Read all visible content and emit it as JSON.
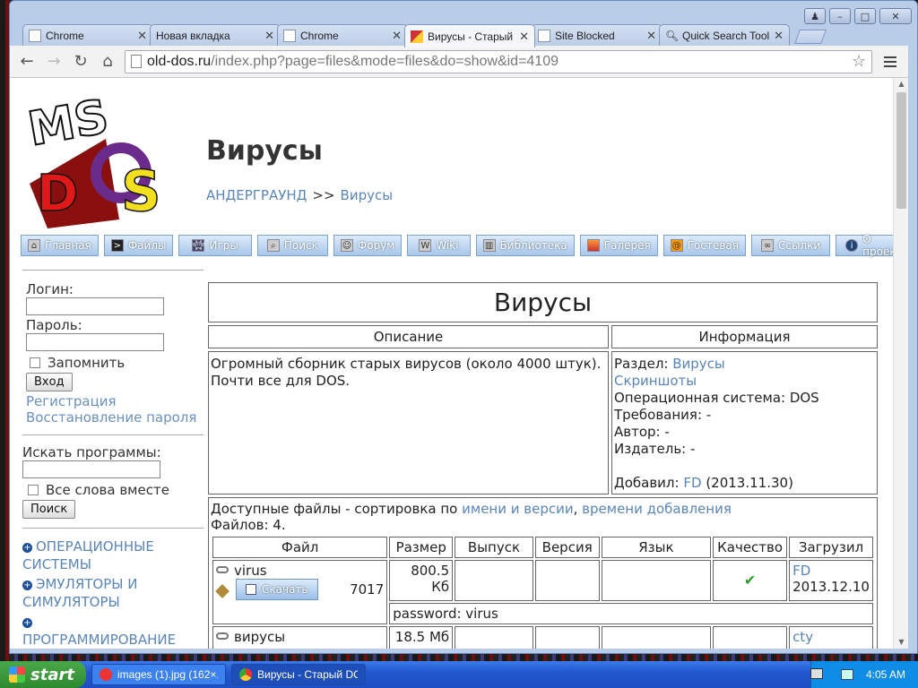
{
  "tabs": [
    {
      "title": "Chrome",
      "active": false
    },
    {
      "title": "Новая вкладка",
      "active": false
    },
    {
      "title": "Chrome",
      "active": false
    },
    {
      "title": "Вирусы - Старый DOS",
      "active": true
    },
    {
      "title": "Site Blocked",
      "active": false
    },
    {
      "title": "Quick Search Tool",
      "active": false
    }
  ],
  "url": {
    "host": "old-dos.ru",
    "rest": "/index.php?page=files&mode=files&do=show&id=4109"
  },
  "header": {
    "title": "Вирусы",
    "crumb_parent": "АНДЕРГРАУНД",
    "crumb_sep": ">>",
    "crumb_current": "Вирусы"
  },
  "nav": [
    {
      "label": "Главная",
      "icon": "home-icon"
    },
    {
      "label": "Файлы",
      "icon": "terminal-icon"
    },
    {
      "label": "Игры",
      "icon": "invader-icon"
    },
    {
      "label": "Поиск",
      "icon": "search-icon"
    },
    {
      "label": "Форум",
      "icon": "user-icon"
    },
    {
      "label": "Wiki",
      "icon": "wiki-icon"
    },
    {
      "label": "Библиотека",
      "icon": "book-icon"
    },
    {
      "label": "Галерея",
      "icon": "picture-icon"
    },
    {
      "label": "Гостевая",
      "icon": "guestbook-icon"
    },
    {
      "label": "Ссылки",
      "icon": "link-icon"
    },
    {
      "label": "О проекте",
      "icon": "info-icon"
    }
  ],
  "sidebar": {
    "login_label": "Логин:",
    "password_label": "Пароль:",
    "remember_label": "Запомнить",
    "login_button": "Вход",
    "register_link": "Регистрация",
    "restore_link": "Восстановление пароля",
    "search_label": "Искать программы:",
    "all_words_label": "Все слова вместе",
    "search_button": "Поиск",
    "categories": [
      "ОПЕРАЦИОННЫЕ СИСТЕМЫ",
      "ЭМУЛЯТОРЫ И СИМУЛЯТОРЫ",
      "ПРОГРАММИРОВАНИЕ"
    ]
  },
  "main": {
    "title": "Вирусы",
    "desc_header": "Описание",
    "info_header": "Информация",
    "description": "Огромный сборник старых вирусов (около 4000 штук). Почти все для DOS.",
    "info": {
      "section_label": "Раздел:",
      "section_value": "Вирусы",
      "screenshots_link": "Скриншоты",
      "os": "Операционная система: DOS",
      "requirements": "Требования: -",
      "author": "Автор: -",
      "publisher": "Издатель: -",
      "added_label": "Добавил:",
      "added_by": "FD",
      "added_date": "(2013.11.30)"
    },
    "files": {
      "sort_prefix": "Доступные файлы - сортировка по",
      "sort_by_name": "имени и версии",
      "sort_comma": ",",
      "sort_by_time": "времени добавления",
      "count": "Файлов: 4.",
      "columns": [
        "Файл",
        "Размер",
        "Выпуск",
        "Версия",
        "Язык",
        "Качество",
        "Загрузил"
      ],
      "rows": [
        {
          "name": "virus",
          "download": "Скачать",
          "downloads": "7017",
          "size": "800.5 Кб",
          "release": "",
          "version": "",
          "language": "",
          "quality": "✔",
          "uploader": "FD",
          "date": "2013.12.10",
          "note": "password: virus"
        },
        {
          "name": "вирусы",
          "size": "18.5 Мб",
          "uploader": "cty"
        }
      ]
    }
  },
  "taskbar": {
    "start": "start",
    "items": [
      {
        "label": "images (1).jpg (162×...",
        "active": false
      },
      {
        "label": "Вирусы - Старый DO...",
        "active": true
      }
    ],
    "clock": "4:05 AM"
  }
}
